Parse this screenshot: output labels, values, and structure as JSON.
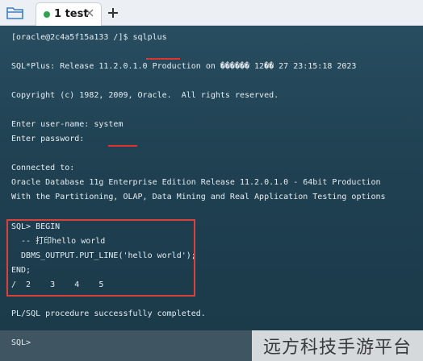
{
  "tabs": [
    {
      "label": "1 test",
      "status_color": "#2ea44f"
    }
  ],
  "icons": {
    "open": "folder-icon",
    "close": "close-icon",
    "add": "plus-icon"
  },
  "terminal": {
    "lines": [
      "[oracle@2c4a5f15a133 /]$ sqlplus",
      "",
      "SQL*Plus: Release 11.2.0.1.0 Production on ������ 12�� 27 23:15:18 2023",
      "",
      "Copyright (c) 1982, 2009, Oracle.  All rights reserved.",
      "",
      "Enter user-name: system",
      "Enter password:",
      "",
      "Connected to:",
      "Oracle Database 11g Enterprise Edition Release 11.2.0.1.0 - 64bit Production",
      "With the Partitioning, OLAP, Data Mining and Real Application Testing options",
      "",
      "SQL> BEGIN",
      "  -- 打印hello world",
      "  DBMS_OUTPUT.PUT_LINE('hello world');",
      "END;",
      "/  2    3    4    5",
      "",
      "PL/SQL procedure successfully completed."
    ],
    "highlight_command": "sqlplus",
    "highlight_username": "system"
  },
  "prompt": {
    "label": "SQL>",
    "value": ""
  },
  "watermark": "远方科技手游平台",
  "colors": {
    "annotation_red": "#d9413a",
    "terminal_bg": "#1f3d4c"
  }
}
